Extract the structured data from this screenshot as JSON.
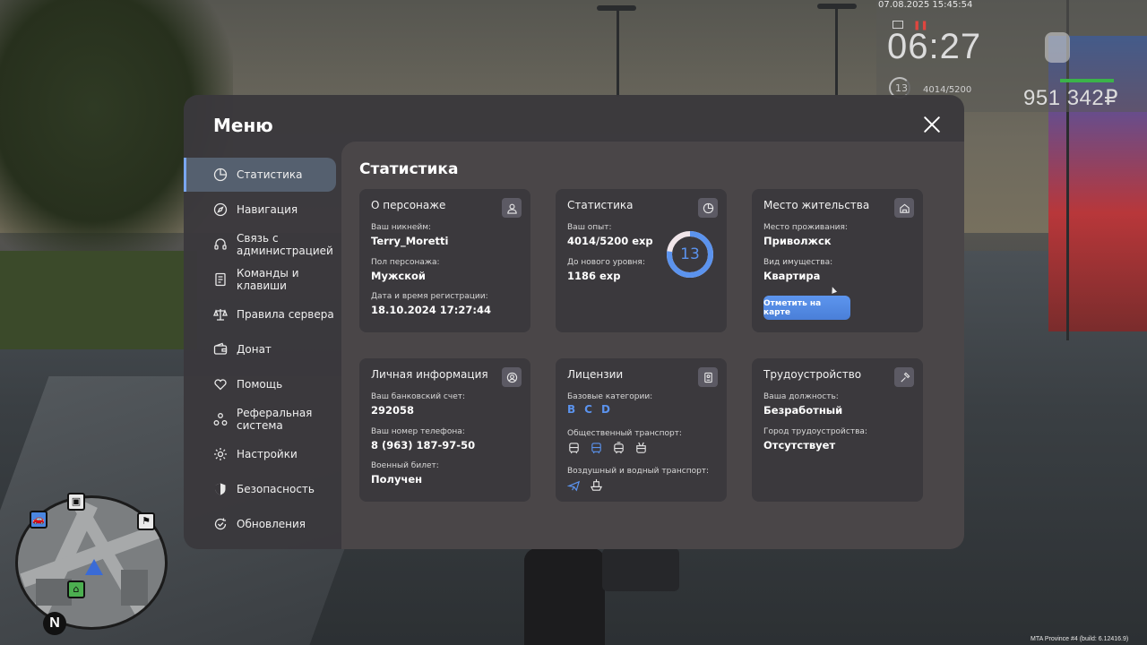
{
  "hud": {
    "datetime": "07.08.2025 15:45:54",
    "time": "06:27",
    "level": "13",
    "exp": "4014/5200",
    "money": "951 342₽"
  },
  "build_info": "MTA Province #4 (build: 6.12416.9)",
  "minimap": {
    "north": "N"
  },
  "menu": {
    "title": "Меню",
    "nav": [
      {
        "label": "Статистика",
        "icon": "pie-chart-icon"
      },
      {
        "label": "Навигация",
        "icon": "compass-icon"
      },
      {
        "label": "Связь с администрацией",
        "icon": "headset-icon"
      },
      {
        "label": "Команды и клавиши",
        "icon": "document-icon"
      },
      {
        "label": "Правила сервера",
        "icon": "scales-icon"
      },
      {
        "label": "Донат",
        "icon": "wallet-icon"
      },
      {
        "label": "Помощь",
        "icon": "heart-hand-icon"
      },
      {
        "label": "Реферальная система",
        "icon": "users-network-icon"
      },
      {
        "label": "Настройки",
        "icon": "gear-icon"
      },
      {
        "label": "Безопасность",
        "icon": "shield-icon"
      },
      {
        "label": "Обновления",
        "icon": "refresh-check-icon"
      }
    ],
    "active_nav": "Статистика"
  },
  "content": {
    "title": "Статистика",
    "character": {
      "title": "О персонаже",
      "nickname_label": "Ваш никнейм:",
      "nickname": "Terry_Moretti",
      "gender_label": "Пол персонажа:",
      "gender": "Мужской",
      "reg_label": "Дата и время регистрации:",
      "reg": "18.10.2024 17:27:44"
    },
    "stats": {
      "title": "Статистика",
      "exp_label": "Ваш опыт:",
      "exp": "4014/5200 exp",
      "next_label": "До нового уровня:",
      "next": "1186 exp",
      "level": "13",
      "progress": 0.772
    },
    "residence": {
      "title": "Место жительства",
      "place_label": "Место проживания:",
      "place": "Приволжск",
      "property_label": "Вид имущества:",
      "property": "Квартира",
      "map_button": "Отметить на карте"
    },
    "personal": {
      "title": "Личная информация",
      "bank_label": "Ваш банковский счет:",
      "bank": "292058",
      "phone_label": "Ваш номер телефона:",
      "phone": "8 (963) 187-97-50",
      "military_label": "Военный билет:",
      "military": "Получен"
    },
    "licenses": {
      "title": "Лицензии",
      "base_label": "Базовые категории:",
      "base": [
        "B",
        "C",
        "D"
      ],
      "public_label": "Общественный транспорт:",
      "public_icons": [
        "bus-icon",
        "bus-front-icon",
        "tram-icon",
        "trolleybus-icon"
      ],
      "air_label": "Воздушный и водный транспорт:",
      "air_icons": [
        "airplane-icon",
        "boat-icon"
      ]
    },
    "employment": {
      "title": "Трудоустройство",
      "position_label": "Ваша должность:",
      "position": "Безработный",
      "city_label": "Город трудоустройства:",
      "city": "Отсутствует"
    }
  },
  "colors": {
    "accent": "#5b93ee",
    "panel": "#3a383c",
    "content": "#4a4648",
    "card": "#3b393d"
  }
}
